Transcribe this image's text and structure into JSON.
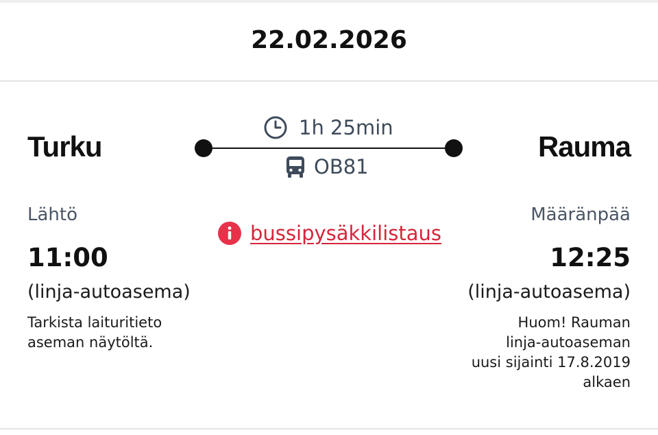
{
  "trip": {
    "date": "22.02.2026",
    "origin": {
      "city": "Turku",
      "label": "Lähtö",
      "time": "11:00",
      "station": "(linja-autoasema)",
      "note_lines": [
        "Tarkista laituritieto",
        "aseman näytöltä."
      ]
    },
    "destination": {
      "city": "Rauma",
      "label": "Määränpää",
      "time": "12:25",
      "station": "(linja-autoasema)",
      "note_lines": [
        "Huom! Rauman",
        "linja-autoaseman",
        "uusi sijainti 17.8.2019",
        "alkaen"
      ]
    },
    "duration": "1h 25min",
    "line_code": "OB81",
    "stops_link": "bussipysäkkilistaus"
  },
  "icons": {
    "duration": "clock-icon",
    "line": "bus-icon",
    "stops_link": "info-icon"
  },
  "colors": {
    "link": "#d6253a",
    "muted_text": "#3d4a5a",
    "primary_text": "#111111",
    "divider": "#e4e4e4"
  }
}
